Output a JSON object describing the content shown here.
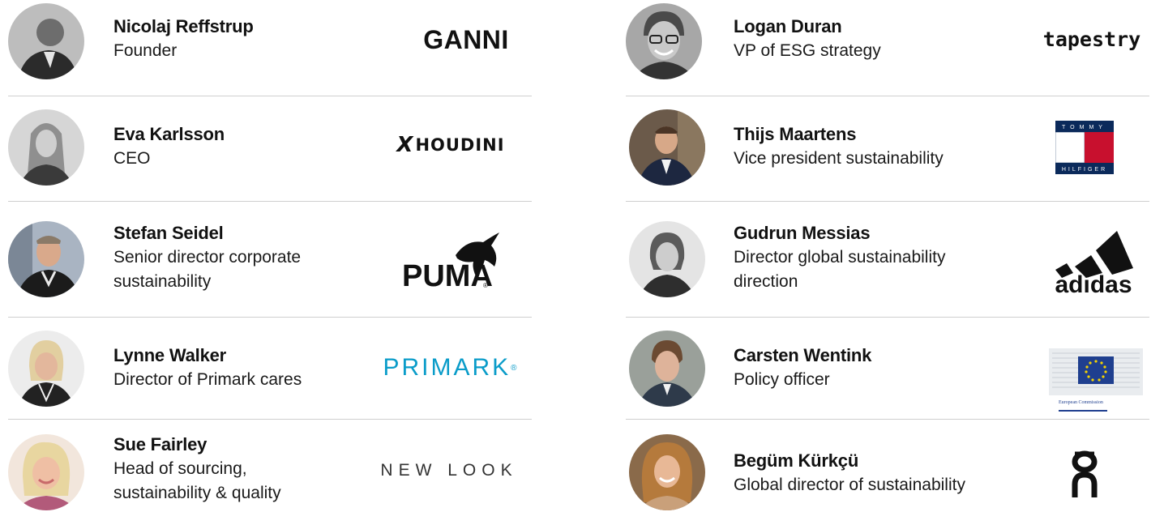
{
  "left": [
    {
      "name": "Nicolaj Reffstrup",
      "role": [
        "Founder"
      ],
      "logo": "GANNI",
      "avatar": "grayscale-portrait"
    },
    {
      "name": "Eva Karlsson",
      "role": [
        "CEO"
      ],
      "logo": "HOUDINI",
      "logo_mark": "X",
      "avatar": "grayscale-portrait"
    },
    {
      "name": "Stefan Seidel",
      "role": [
        "Senior director corporate",
        "sustainability"
      ],
      "logo": "PUMA",
      "avatar": "color-portrait"
    },
    {
      "name": "Lynne Walker",
      "role": [
        "Director of Primark cares"
      ],
      "logo": "PRIMARK",
      "avatar": "color-portrait"
    },
    {
      "name": "Sue Fairley",
      "role": [
        "Head of sourcing,",
        "sustainability & quality"
      ],
      "logo": "NEW LOOK",
      "avatar": "color-portrait"
    }
  ],
  "right": [
    {
      "name": "Logan Duran",
      "role": [
        "VP of ESG strategy"
      ],
      "logo": "tapestry",
      "avatar": "grayscale-portrait"
    },
    {
      "name": "Thijs Maartens",
      "role": [
        "Vice president sustainability"
      ],
      "logo_top": "TOMMY",
      "logo_bottom": "HILFIGER",
      "avatar": "color-portrait"
    },
    {
      "name": "Gudrun Messias",
      "role": [
        "Director global sustainability",
        "direction"
      ],
      "logo": "adidas",
      "avatar": "grayscale-portrait"
    },
    {
      "name": "Carsten Wentink",
      "role": [
        "Policy officer"
      ],
      "logo": "European Commission",
      "avatar": "color-portrait"
    },
    {
      "name": "Begüm Kürkçü",
      "role": [
        "Global director of sustainability"
      ],
      "logo": "On",
      "avatar": "color-portrait"
    }
  ],
  "colors": {
    "text": "#111111",
    "divider": "#cfcfcf",
    "primark": "#0a9cc9",
    "tommy_navy": "#0b2a5b",
    "tommy_red": "#c8102e",
    "eu_blue": "#1f3f8f",
    "eu_gold": "#f5d300"
  }
}
